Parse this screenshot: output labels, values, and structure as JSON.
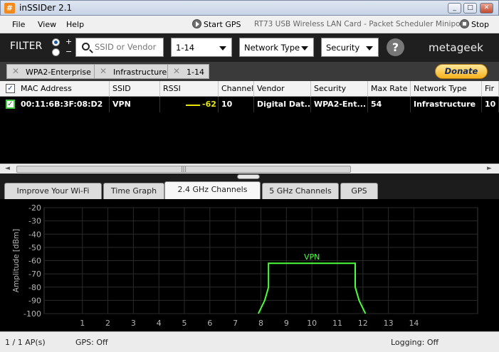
{
  "window": {
    "app_icon": "#",
    "title": "inSSIDer 2.1",
    "minimize": "_",
    "maximize": "□",
    "close": "✕"
  },
  "menu": {
    "items": [
      "File",
      "View",
      "Help"
    ],
    "start_gps": "Start GPS",
    "adapter": "RT73 USB Wireless LAN Card - Packet Scheduler Miniport",
    "stop": "Stop"
  },
  "filter": {
    "label": "FILTER",
    "plus": "+",
    "minus": "−",
    "search_placeholder": "SSID or Vendor",
    "channel_select": "1-14",
    "network_type_select": "Network Type",
    "security_select": "Security",
    "help": "?",
    "brand": "metageek"
  },
  "active_filters": {
    "chips": [
      "WPA2-Enterprise",
      "Infrastructure",
      "1-14"
    ],
    "remove_glyph": "✕",
    "donate": "Donate"
  },
  "table": {
    "header_check": "✓",
    "columns": [
      "MAC Address",
      "SSID",
      "RSSI",
      "Channel",
      "Vendor",
      "Security",
      "Max Rate",
      "Network Type",
      "Fir"
    ],
    "rows": [
      {
        "check": "✓",
        "mac": "00:11:6B:3F:08:D2",
        "ssid": "VPN",
        "rssi": "-62",
        "channel": "10",
        "vendor": "Digital Dat...",
        "security": "WPA2-Ent...",
        "max_rate": "54",
        "network_type": "Infrastructure",
        "first_seen": "10"
      }
    ],
    "rssi_line_color": "#e8e800"
  },
  "scrollbar": {
    "left_arrow": "◄",
    "right_arrow": "►",
    "grip": "|||"
  },
  "tabs": [
    "Improve Your Wi-Fi",
    "Time Graph",
    "2.4 GHz Channels",
    "5 GHz Channels",
    "GPS"
  ],
  "active_tab": "2.4 GHz Channels",
  "chart_data": {
    "type": "area",
    "ylabel": "Amplitude [dBm]",
    "ylim": [
      -100,
      -20
    ],
    "y_ticks": [
      -20,
      -30,
      -40,
      -50,
      -60,
      -70,
      -80,
      -90,
      -100
    ],
    "x_ticks": [
      1,
      2,
      3,
      4,
      5,
      6,
      7,
      8,
      9,
      10,
      11,
      12,
      13,
      14
    ],
    "xlim": [
      -0.5,
      16.5
    ],
    "grid": true,
    "series": [
      {
        "name": "VPN",
        "color": "#4cff3a",
        "center_channel": 10,
        "rssi": -62,
        "points": [
          [
            7.9,
            -100
          ],
          [
            8.15,
            -90
          ],
          [
            8.3,
            -80
          ],
          [
            8.3,
            -62
          ],
          [
            11.7,
            -62
          ],
          [
            11.7,
            -80
          ],
          [
            11.85,
            -90
          ],
          [
            12.1,
            -100
          ]
        ]
      }
    ],
    "colors": {
      "background": "#000000",
      "grid": "#2a2a2a",
      "axis_text": "#b4b4b4"
    }
  },
  "status": {
    "aps": "1 / 1 AP(s)",
    "gps": "GPS: Off",
    "logging": "Logging: Off"
  }
}
